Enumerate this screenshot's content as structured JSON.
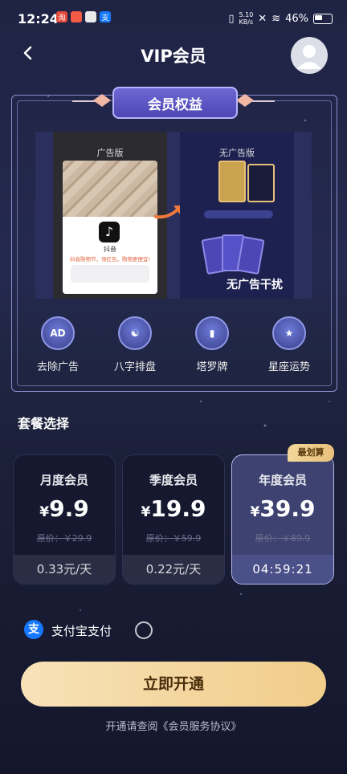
{
  "status": {
    "time": "12:24",
    "net_speed": "5.10\nKB/s",
    "battery": "46%"
  },
  "header": {
    "title": "VIP会员"
  },
  "benefits": {
    "tab_title": "会员权益",
    "left_label": "广告版",
    "right_label": "无广告版",
    "ad_app_name": "抖音",
    "ad_desc": "抖音购物节，领红包，购物更便宜!",
    "overlay_text": "无广告干扰",
    "features": [
      {
        "icon": "remove-ad-icon",
        "label": "去除广告"
      },
      {
        "icon": "bazi-icon",
        "label": "八字排盘"
      },
      {
        "icon": "tarot-icon",
        "label": "塔罗牌"
      },
      {
        "icon": "horoscope-icon",
        "label": "星座运势"
      }
    ]
  },
  "plans_section": {
    "title": "套餐选择"
  },
  "plans": [
    {
      "name": "月度会员",
      "currency": "¥",
      "price": "9.9",
      "original": "原价：￥29.9",
      "footer": "0.33元/天"
    },
    {
      "name": "季度会员",
      "currency": "¥",
      "price": "19.9",
      "original": "原价：￥59.9",
      "footer": "0.22元/天"
    },
    {
      "name": "年度会员",
      "currency": "¥",
      "price": "39.9",
      "original": "原价：￥89.9",
      "footer": "04:59:21",
      "badge": "最划算"
    }
  ],
  "payment": {
    "label": "支付宝支付",
    "icon_text": "支"
  },
  "cta": {
    "label": "立即开通"
  },
  "agreement": {
    "text": "开通请查阅《会员服务协议》"
  },
  "colors": {
    "accent": "#6d67d4",
    "gold": "#f1cd8a",
    "bg": "#1f2344"
  }
}
